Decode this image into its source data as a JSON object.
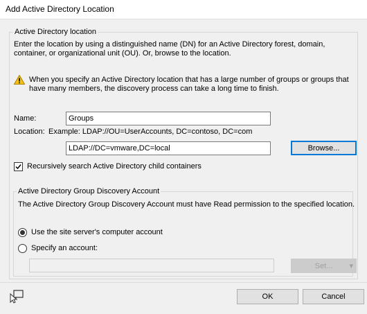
{
  "window": {
    "title": "Add Active Directory Location"
  },
  "location_group": {
    "legend": "Active Directory location",
    "intro": "Enter the location by using a distinguished name (DN) for an Active Directory forest, domain, container, or organizational unit (OU). Or, browse to the location.",
    "warning": "When you specify an Active Directory location that has a large number of groups or groups that have many members, the discovery process can take a long time to finish.",
    "name_label": "Name:",
    "name_value": "Groups",
    "location_label": "Location:",
    "location_example": "Example: LDAP://OU=UserAccounts, DC=contoso, DC=com",
    "location_value": "LDAP://DC=vmware,DC=local",
    "browse_button": "Browse...",
    "recursive_label": "Recursively search Active Directory child containers",
    "recursive_checked": true
  },
  "account_group": {
    "legend": "Active Directory Group Discovery Account",
    "description": "The Active Directory Group Discovery Account must have Read permission to the specified location.",
    "option_site_server": "Use the site server's computer account",
    "option_specify": "Specify an account:",
    "selected_option": "site_server",
    "account_value": "",
    "set_button": "Set...",
    "set_arrow": "▾"
  },
  "footer": {
    "ok_button": "OK",
    "cancel_button": "Cancel",
    "help_icon": "help-pointer-icon"
  },
  "colors": {
    "focus_border": "#0078d7",
    "warning_yellow": "#f5c211"
  }
}
